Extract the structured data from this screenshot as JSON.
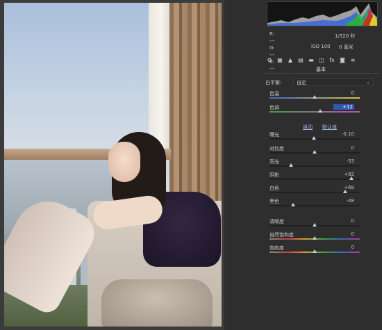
{
  "histogram": {
    "colors": [
      "#e02020",
      "#20c020",
      "#2050e0",
      "#e0e020",
      "#20e0e0",
      "#e020e0"
    ]
  },
  "meta": {
    "r_label": "R:",
    "r_value": "---",
    "g_label": "G:",
    "g_value": "---",
    "b_label": "B:",
    "b_value": "---",
    "shutter": "1/320 秒",
    "iso": "ISO 100",
    "focal": "0 毫米"
  },
  "toolbar": {
    "tools": [
      "basic-icon",
      "tone-curve-icon",
      "detail-icon",
      "hsl-icon",
      "split-tone-icon",
      "lens-icon",
      "fx-icon",
      "camera-calibration-icon",
      "presets-icon"
    ],
    "fx_label": "fx"
  },
  "section_title": "基本",
  "white_balance": {
    "label": "白平衡:",
    "value": "自定"
  },
  "sliders": [
    {
      "key": "temp",
      "label": "色温",
      "value": "0",
      "pos": 0.5,
      "track": "temp",
      "highlight": false
    },
    {
      "key": "tint",
      "label": "色调",
      "value": "+12",
      "pos": 0.56,
      "track": "tint",
      "highlight": true
    },
    {
      "key": "exposure",
      "label": "曝光",
      "value": "-0.10",
      "pos": 0.49,
      "track": "plain",
      "highlight": false
    },
    {
      "key": "contrast",
      "label": "对比度",
      "value": "0",
      "pos": 0.5,
      "track": "plain",
      "highlight": false
    },
    {
      "key": "highlights",
      "label": "高光",
      "value": "-53",
      "pos": 0.235,
      "track": "plain",
      "highlight": false
    },
    {
      "key": "shadows",
      "label": "阴影",
      "value": "+82",
      "pos": 0.91,
      "track": "plain",
      "highlight": false
    },
    {
      "key": "whites",
      "label": "白色",
      "value": "+68",
      "pos": 0.84,
      "track": "plain",
      "highlight": false
    },
    {
      "key": "blacks",
      "label": "黑色",
      "value": "-48",
      "pos": 0.26,
      "track": "plain",
      "highlight": false
    },
    {
      "key": "clarity",
      "label": "清晰度",
      "value": "0",
      "pos": 0.5,
      "track": "plain",
      "highlight": false
    },
    {
      "key": "vibrance",
      "label": "自然饱和度",
      "value": "0",
      "pos": 0.5,
      "track": "vib",
      "highlight": false
    },
    {
      "key": "saturation",
      "label": "饱和度",
      "value": "0",
      "pos": 0.5,
      "track": "vib",
      "highlight": false
    }
  ],
  "tone": {
    "auto": "自动",
    "default": "默认值"
  }
}
